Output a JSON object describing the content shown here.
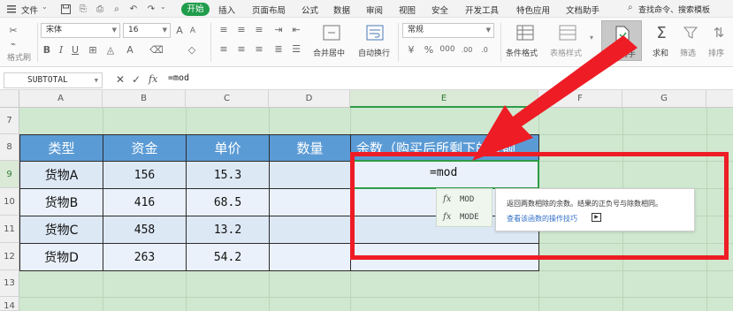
{
  "menubar": {
    "file_label": "文件",
    "start_tab": "开始",
    "tabs": [
      "插入",
      "页面布局",
      "公式",
      "数据",
      "审阅",
      "视图",
      "安全",
      "开发工具",
      "特色应用",
      "文档助手"
    ],
    "search_placeholder": "查找命令、搜索模板"
  },
  "ribbon": {
    "format_painter": "格式刷",
    "font_name": "宋体",
    "font_size": "16",
    "number_format": "常规",
    "merge_center": "合并居中",
    "wrap_text": "自动换行",
    "conditional_format": "条件格式",
    "table_style": "表格样式",
    "doc_assistant": "文档助手",
    "sum": "求和",
    "filter": "筛选",
    "sort": "排序"
  },
  "formula_bar": {
    "name_box": "SUBTOTAL",
    "fx_label": "fx",
    "content": "=mod"
  },
  "grid": {
    "columns": [
      "A",
      "B",
      "C",
      "D",
      "E",
      "F",
      "G"
    ],
    "rows": [
      "7",
      "8",
      "9",
      "10",
      "11",
      "12",
      "13",
      "14"
    ],
    "selected_column": "E",
    "selected_row": "9"
  },
  "table": {
    "headers": [
      "类型",
      "资金",
      "单价",
      "数量",
      "余数（购买后所剩下的金额"
    ],
    "rows": [
      [
        "货物A",
        "156",
        "15.3",
        "",
        "=mod"
      ],
      [
        "货物B",
        "416",
        "68.5",
        "",
        ""
      ],
      [
        "货物C",
        "458",
        "13.2",
        "",
        ""
      ],
      [
        "货物D",
        "263",
        "54.2",
        "",
        ""
      ]
    ]
  },
  "autocomplete": {
    "items": [
      "MOD",
      "MODE"
    ],
    "fx": "fx",
    "description": "返回两数相除的余数。结果的正负号与除数相同。",
    "help_link": "查看该函数的操作技巧"
  },
  "colors": {
    "accent_green": "#1f9d4b",
    "header_blue": "#5b9bd5",
    "annotation_red": "#ee1c25",
    "sheet_green": "#cfe8cf"
  }
}
